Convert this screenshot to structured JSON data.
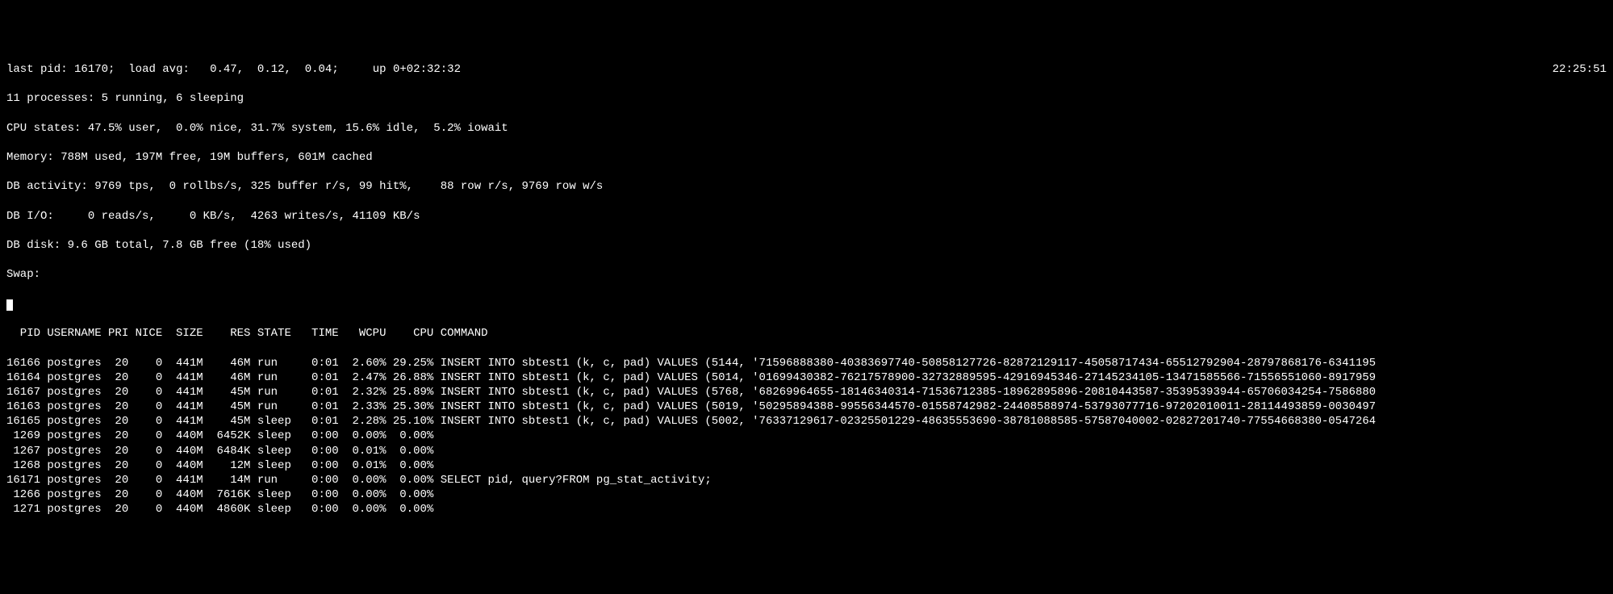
{
  "header": {
    "last_pid_label": "last pid:",
    "last_pid": "16170;",
    "load_avg_label": "load avg:",
    "load_avg": " 0.47,  0.12,  0.04;",
    "uptime_label": "up",
    "uptime": "0+02:32:32",
    "clock": "22:25:51"
  },
  "summary": {
    "processes": "11 processes: 5 running, 6 sleeping",
    "cpu": "CPU states: 47.5% user,  0.0% nice, 31.7% system, 15.6% idle,  5.2% iowait",
    "memory": "Memory: 788M used, 197M free, 19M buffers, 601M cached",
    "db_activity": "DB activity: 9769 tps,  0 rollbs/s, 325 buffer r/s, 99 hit%,    88 row r/s, 9769 row w/s",
    "db_io": "DB I/O:     0 reads/s,     0 KB/s,  4263 writes/s, 41109 KB/s",
    "db_disk": "DB disk: 9.6 GB total, 7.8 GB free (18% used)",
    "swap": "Swap:"
  },
  "columns": {
    "pid": "PID",
    "username": "USERNAME",
    "pri": "PRI",
    "nice": "NICE",
    "size": "SIZE",
    "res": "RES",
    "state": "STATE",
    "time": "TIME",
    "wcpu": "WCPU",
    "cpu": "CPU",
    "command": "COMMAND"
  },
  "rows": [
    {
      "pid": "16166",
      "user": "postgres",
      "pri": "20",
      "nice": "0",
      "size": "441M",
      "res": "46M",
      "state": "run",
      "time": "0:01",
      "wcpu": "2.60%",
      "cpu": "29.25%",
      "cmd": "INSERT INTO sbtest1 (k, c, pad) VALUES (5144, '71596888380-40383697740-50858127726-82872129117-45058717434-65512792904-28797868176-6341195"
    },
    {
      "pid": "16164",
      "user": "postgres",
      "pri": "20",
      "nice": "0",
      "size": "441M",
      "res": "46M",
      "state": "run",
      "time": "0:01",
      "wcpu": "2.47%",
      "cpu": "26.88%",
      "cmd": "INSERT INTO sbtest1 (k, c, pad) VALUES (5014, '01699430382-76217578900-32732889595-42916945346-27145234105-13471585566-71556551060-8917959"
    },
    {
      "pid": "16167",
      "user": "postgres",
      "pri": "20",
      "nice": "0",
      "size": "441M",
      "res": "45M",
      "state": "run",
      "time": "0:01",
      "wcpu": "2.32%",
      "cpu": "25.89%",
      "cmd": "INSERT INTO sbtest1 (k, c, pad) VALUES (5768, '68269964655-18146340314-71536712385-18962895896-20810443587-35395393944-65706034254-7586880"
    },
    {
      "pid": "16163",
      "user": "postgres",
      "pri": "20",
      "nice": "0",
      "size": "441M",
      "res": "45M",
      "state": "run",
      "time": "0:01",
      "wcpu": "2.33%",
      "cpu": "25.30%",
      "cmd": "INSERT INTO sbtest1 (k, c, pad) VALUES (5019, '50295894388-99556344570-01558742982-24408588974-53793077716-97202010011-28114493859-0030497"
    },
    {
      "pid": "16165",
      "user": "postgres",
      "pri": "20",
      "nice": "0",
      "size": "441M",
      "res": "45M",
      "state": "sleep",
      "time": "0:01",
      "wcpu": "2.28%",
      "cpu": "25.10%",
      "cmd": "INSERT INTO sbtest1 (k, c, pad) VALUES (5002, '76337129617-02325501229-48635553690-38781088585-57587040002-02827201740-77554668380-0547264"
    },
    {
      "pid": "1269",
      "user": "postgres",
      "pri": "20",
      "nice": "0",
      "size": "440M",
      "res": "6452K",
      "state": "sleep",
      "time": "0:00",
      "wcpu": "0.00%",
      "cpu": "0.00%",
      "cmd": ""
    },
    {
      "pid": "1267",
      "user": "postgres",
      "pri": "20",
      "nice": "0",
      "size": "440M",
      "res": "6484K",
      "state": "sleep",
      "time": "0:00",
      "wcpu": "0.01%",
      "cpu": "0.00%",
      "cmd": ""
    },
    {
      "pid": "1268",
      "user": "postgres",
      "pri": "20",
      "nice": "0",
      "size": "440M",
      "res": "12M",
      "state": "sleep",
      "time": "0:00",
      "wcpu": "0.01%",
      "cpu": "0.00%",
      "cmd": ""
    },
    {
      "pid": "16171",
      "user": "postgres",
      "pri": "20",
      "nice": "0",
      "size": "441M",
      "res": "14M",
      "state": "run",
      "time": "0:00",
      "wcpu": "0.00%",
      "cpu": "0.00%",
      "cmd": "SELECT pid, query?FROM pg_stat_activity;"
    },
    {
      "pid": "1266",
      "user": "postgres",
      "pri": "20",
      "nice": "0",
      "size": "440M",
      "res": "7616K",
      "state": "sleep",
      "time": "0:00",
      "wcpu": "0.00%",
      "cpu": "0.00%",
      "cmd": ""
    },
    {
      "pid": "1271",
      "user": "postgres",
      "pri": "20",
      "nice": "0",
      "size": "440M",
      "res": "4860K",
      "state": "sleep",
      "time": "0:00",
      "wcpu": "0.00%",
      "cpu": "0.00%",
      "cmd": ""
    }
  ]
}
